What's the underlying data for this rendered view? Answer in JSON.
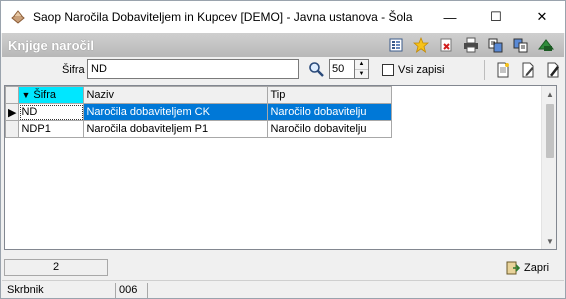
{
  "window": {
    "title": "Saop Naročila Dobaviteljem in Kupcev [DEMO] - Javna ustanova - Šola",
    "minimize_glyph": "—",
    "maximize_glyph": "☐",
    "close_glyph": "✕"
  },
  "form": {
    "title": "Knjige naročil"
  },
  "toolbar": {
    "icons": [
      "list-icon",
      "star-icon",
      "delete-icon",
      "printer-icon",
      "copy-icon",
      "copy-alt-icon",
      "exit-icon"
    ]
  },
  "filter": {
    "label": "Šifra",
    "value": "ND",
    "count": "50",
    "show_all_label": "Vsi zapisi",
    "show_all_checked": false
  },
  "grid": {
    "columns": [
      "Šifra",
      "Naziv",
      "Tip"
    ],
    "sort_column": "Šifra",
    "rows": [
      {
        "sifra": "ND",
        "naziv": "Naročila dobaviteljem CK",
        "tip": "Naročilo dobavitelju",
        "selected": true
      },
      {
        "sifra": "NDP1",
        "naziv": "Naročila dobaviteljem P1",
        "tip": "Naročilo dobavitelju",
        "selected": false
      }
    ]
  },
  "footer": {
    "record_count": "2",
    "close_label": "Zapri"
  },
  "statusbar": {
    "user": "Skrbnik",
    "code": "006"
  },
  "colors": {
    "sort_header": "#00e7ff",
    "selection": "#0078d7"
  }
}
